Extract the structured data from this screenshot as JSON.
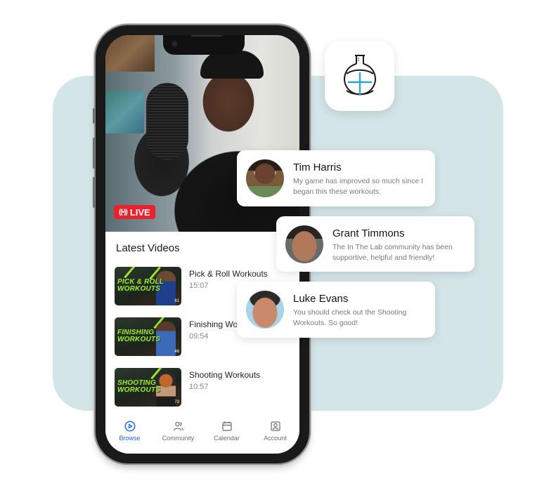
{
  "brand": {
    "app_icon": "flask-basketball-icon",
    "icon_accent": "#2aa7c9",
    "panel_color": "#d4e5e8"
  },
  "phone": {
    "hero": {
      "live_label": "LIVE",
      "live_icon": "broadcast-icon",
      "live_color": "#e8232e"
    },
    "latest_videos": {
      "title": "Latest Videos",
      "items": [
        {
          "title": "Pick & Roll Workouts",
          "duration": "15:07",
          "thumb_text": "PICK & ROLL\nWORKOUTS",
          "thumb_views": "81"
        },
        {
          "title": "Finishing Workouts",
          "duration": "09:54",
          "thumb_text": "FINISHING\nWORKOUTS",
          "thumb_views": "46"
        },
        {
          "title": "Shooting Workouts",
          "duration": "10:57",
          "thumb_text": "SHOOTING\nWORKOUTS",
          "thumb_views": "73"
        }
      ]
    },
    "tabbar": {
      "active_color": "#1f6ae0",
      "tabs": [
        {
          "label": "Browse",
          "icon": "play-circle-icon",
          "active": true
        },
        {
          "label": "Community",
          "icon": "users-icon",
          "active": false
        },
        {
          "label": "Calendar",
          "icon": "calendar-icon",
          "active": false
        },
        {
          "label": "Account",
          "icon": "account-icon",
          "active": false
        }
      ]
    }
  },
  "testimonials": [
    {
      "name": "Tim Harris",
      "text": "My game has improved so much since I began this these workouts."
    },
    {
      "name": "Grant Timmons",
      "text": "The In The Lab community has been supportive, helpful and friendly!"
    },
    {
      "name": "Luke Evans",
      "text": "You should check out the Shooting Workouts. So good!"
    }
  ]
}
